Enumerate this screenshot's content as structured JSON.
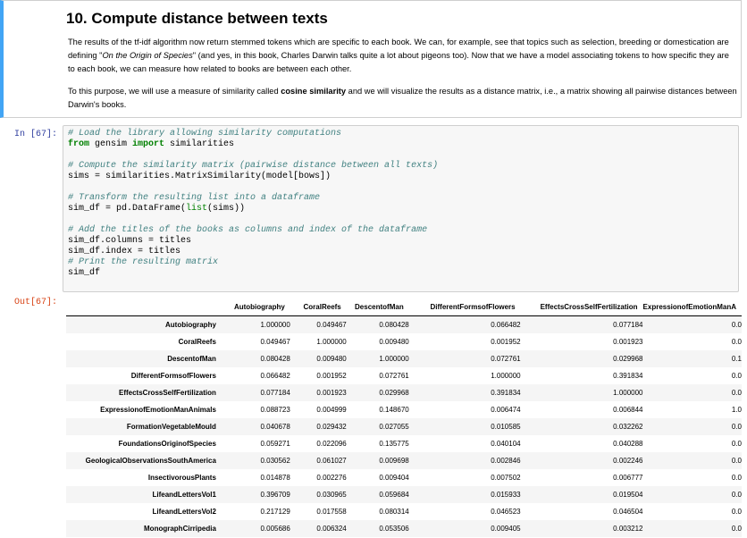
{
  "markdown": {
    "title": "10. Compute distance between texts",
    "p1_a": "The results of the tf-idf algorithm now return stemmed tokens which are specific to each book. We can, for example, see that topics such as selection, breeding or domestication are defining \"",
    "p1_em": "On the Origin of Species",
    "p1_b": "\" (and yes, in this book, Charles Darwin talks quite a lot about pigeons too). Now that we have a model associating tokens to how specific they are to each book, we can measure how related to books are between each other.",
    "p2_a": "To this purpose, we will use a measure of similarity called ",
    "p2_strong": "cosine similarity",
    "p2_b": " and we will visualize the results as a distance matrix, i.e., a matrix showing all pairwise distances between Darwin's books."
  },
  "code_cell": {
    "prompt": "In [67]:",
    "c1": "# Load the library allowing similarity computations",
    "l2_kw1": "from",
    "l2_mid": " gensim ",
    "l2_kw2": "import",
    "l2_end": " similarities",
    "c2": "# Compute the similarity matrix (pairwise distance between all texts)",
    "l4": "sims = similarities.MatrixSimilarity(model[bows])",
    "c3": "# Transform the resulting list into a dataframe",
    "l6_a": "sim_df = pd.DataFrame(",
    "l6_bi": "list",
    "l6_b": "(sims))",
    "c4": "# Add the titles of the books as columns and index of the dataframe",
    "l8": "sim_df.columns = titles",
    "l9": "sim_df.index = titles",
    "c5": "# Print the resulting matrix",
    "l11": "sim_df"
  },
  "output": {
    "prompt": "Out[67]:",
    "columns": [
      "Autobiography",
      "CoralReefs",
      "DescentofMan",
      "DifferentFormsofFlowers",
      "EffectsCrossSelfFertilization",
      "ExpressionofEmotionManA"
    ],
    "rows": [
      {
        "label": "Autobiography",
        "values": [
          "1.000000",
          "0.049467",
          "0.080428",
          "0.066482",
          "0.077184",
          "0.0"
        ]
      },
      {
        "label": "CoralReefs",
        "values": [
          "0.049467",
          "1.000000",
          "0.009480",
          "0.001952",
          "0.001923",
          "0.0"
        ]
      },
      {
        "label": "DescentofMan",
        "values": [
          "0.080428",
          "0.009480",
          "1.000000",
          "0.072761",
          "0.029968",
          "0.1"
        ]
      },
      {
        "label": "DifferentFormsofFlowers",
        "values": [
          "0.066482",
          "0.001952",
          "0.072761",
          "1.000000",
          "0.391834",
          "0.0"
        ]
      },
      {
        "label": "EffectsCrossSelfFertilization",
        "values": [
          "0.077184",
          "0.001923",
          "0.029968",
          "0.391834",
          "1.000000",
          "0.0"
        ]
      },
      {
        "label": "ExpressionofEmotionManAnimals",
        "values": [
          "0.088723",
          "0.004999",
          "0.148670",
          "0.006474",
          "0.006844",
          "1.0"
        ]
      },
      {
        "label": "FormationVegetableMould",
        "values": [
          "0.040678",
          "0.029432",
          "0.027055",
          "0.010585",
          "0.032262",
          "0.0"
        ]
      },
      {
        "label": "FoundationsOriginofSpecies",
        "values": [
          "0.059271",
          "0.022096",
          "0.135775",
          "0.040104",
          "0.040288",
          "0.0"
        ]
      },
      {
        "label": "GeologicalObservationsSouthAmerica",
        "values": [
          "0.030562",
          "0.061027",
          "0.009698",
          "0.002846",
          "0.002246",
          "0.0"
        ]
      },
      {
        "label": "InsectivorousPlants",
        "values": [
          "0.014878",
          "0.002276",
          "0.009404",
          "0.007502",
          "0.006777",
          "0.0"
        ]
      },
      {
        "label": "LifeandLettersVol1",
        "values": [
          "0.396709",
          "0.030965",
          "0.059684",
          "0.015933",
          "0.019504",
          "0.0"
        ]
      },
      {
        "label": "LifeandLettersVol2",
        "values": [
          "0.217129",
          "0.017558",
          "0.080314",
          "0.046523",
          "0.046504",
          "0.0"
        ]
      },
      {
        "label": "MonographCirripedia",
        "values": [
          "0.005686",
          "0.006324",
          "0.053506",
          "0.009405",
          "0.003212",
          "0.0"
        ]
      }
    ]
  },
  "colors": {
    "cell_border_accent": "#42a5f5",
    "in_prompt": "#303f9f",
    "out_prompt": "#d84315",
    "comment": "#408080",
    "keyword": "#008000"
  }
}
